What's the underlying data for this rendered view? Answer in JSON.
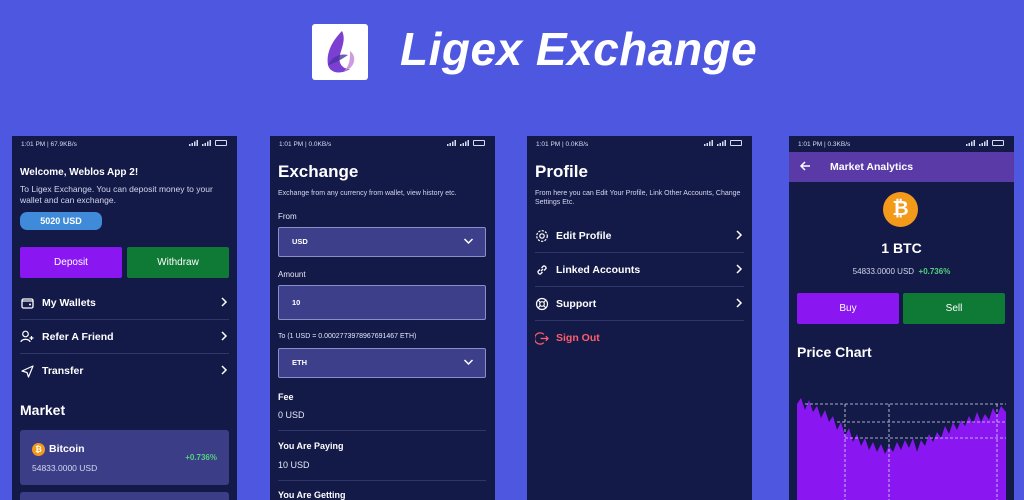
{
  "app": {
    "title": "Ligex Exchange"
  },
  "colors": {
    "background": "#4d57e0",
    "phone_bg": "#141a48",
    "accent_purple": "#8a17f2",
    "accent_green": "#0f7a35",
    "positive": "#54d07e",
    "danger": "#ff5e6a",
    "bitcoin": "#f39a1b"
  },
  "screens": {
    "home": {
      "status": "1:01 PM | 67.9KB/s",
      "welcome": "Welcome, Weblos App 2!",
      "intro": "To Ligex Exchange. You can deposit money to your wallet and can exchange.",
      "balance": "5020 USD",
      "deposit_label": "Deposit",
      "withdraw_label": "Withdraw",
      "menu": [
        {
          "label": "My Wallets",
          "icon": "wallet-icon"
        },
        {
          "label": "Refer A Friend",
          "icon": "add-user-icon"
        },
        {
          "label": "Transfer",
          "icon": "send-icon"
        }
      ],
      "market_title": "Market",
      "market": [
        {
          "name": "Bitcoin",
          "price": "54833.0000 USD",
          "change": "+0.736%"
        }
      ]
    },
    "exchange": {
      "status": "1:01 PM | 0.0KB/s",
      "title": "Exchange",
      "description": "Exchange from any currency from wallet, view history etc.",
      "from_label": "From",
      "from_value": "USD",
      "amount_label": "Amount",
      "amount_value": "10",
      "rate_label": "To (1 USD = 0.0002773978967691467 ETH)",
      "to_value": "ETH",
      "fee_label": "Fee",
      "fee_value": "0 USD",
      "paying_label": "You Are Paying",
      "paying_value": "10 USD",
      "getting_label": "You Are Getting"
    },
    "profile": {
      "status": "1:01 PM | 0.0KB/s",
      "title": "Profile",
      "description": "From here you can Edit Your Profile, Link Other Accounts, Change Settings Etc.",
      "items": [
        {
          "label": "Edit Profile",
          "icon": "gear-icon"
        },
        {
          "label": "Linked Accounts",
          "icon": "link-icon"
        },
        {
          "label": "Support",
          "icon": "lifebuoy-icon"
        }
      ],
      "signout_label": "Sign Out"
    },
    "analytics": {
      "status": "1:01 PM | 0.3KB/s",
      "title": "Market Analytics",
      "amount": "1 BTC",
      "price": "54833.0000 USD",
      "change": "+0.736%",
      "buy_label": "Buy",
      "sell_label": "Sell",
      "chart_title": "Price Chart"
    }
  }
}
